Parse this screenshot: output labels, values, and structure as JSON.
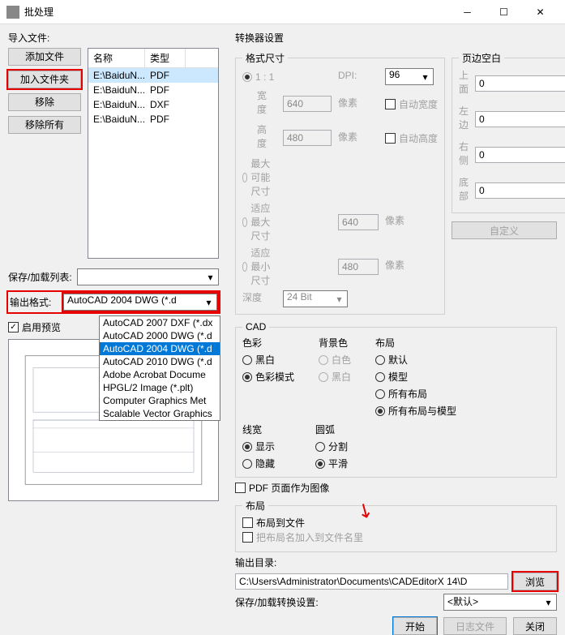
{
  "window": {
    "title": "批处理"
  },
  "left": {
    "import_label": "导入文件:",
    "add_file": "添加文件",
    "add_folder": "加入文件夹",
    "remove": "移除",
    "remove_all": "移除所有",
    "save_load_list": "保存/加载列表:",
    "output_format": "输出格式:",
    "format_value": "AutoCAD 2004 DWG (*.d",
    "enable_preview": "启用预览",
    "dropdown": [
      "AutoCAD 2007 DXF (*.dx",
      "AutoCAD 2000 DWG (*.d",
      "AutoCAD 2004 DWG (*.d",
      "AutoCAD 2010 DWG (*.d",
      "Adobe Acrobat Docume",
      "HPGL/2 Image (*.plt)",
      "Computer Graphics Met",
      "Scalable Vector Graphics"
    ]
  },
  "files": {
    "col_name": "名称",
    "col_type": "类型",
    "rows": [
      {
        "name": "E:\\BaiduN...",
        "type": "PDF"
      },
      {
        "name": "E:\\BaiduN...",
        "type": "PDF"
      },
      {
        "name": "E:\\BaiduN...",
        "type": "DXF"
      },
      {
        "name": "E:\\BaiduN...",
        "type": "PDF"
      }
    ]
  },
  "converter": {
    "title": "转换器设置",
    "format_size": "格式尺寸",
    "one_to_one": "1 : 1",
    "dpi": "DPI:",
    "dpi_val": "96",
    "width_lbl": "宽度",
    "width_val": "640",
    "height_lbl": "高度",
    "height_val": "480",
    "px": "像素",
    "auto_width": "自动宽度",
    "auto_height": "自动高度",
    "max_possible": "最大可能尺寸",
    "fit_max": "适应最大尺寸",
    "fit_max_val": "640",
    "fit_min": "适应最小尺寸",
    "fit_min_val": "480",
    "depth": "深度",
    "depth_val": "24 Bit",
    "margins": "页边空白",
    "top": "上面",
    "top_v": "0",
    "left": "左边",
    "left_v": "0",
    "right": "右侧",
    "right_v": "0",
    "bottom": "底部",
    "bottom_v": "0",
    "custom": "自定义",
    "cad": "CAD",
    "color": "色彩",
    "bw": "黑白",
    "colormode": "色彩模式",
    "bgcolor": "背景色",
    "white": "白色",
    "layout": "布局",
    "default": "默认",
    "model": "模型",
    "all_layouts": "所有布局",
    "all_layouts_model": "所有布局与模型",
    "linewidth": "线宽",
    "show": "显示",
    "hide": "隐藏",
    "arc": "圆弧",
    "split": "分割",
    "smooth": "平滑",
    "pdf_as_image": "PDF 页面作为图像",
    "layout_section": "布局",
    "layout_to_file": "布局到文件",
    "add_layout_name": "把布局名加入到文件名里",
    "output_dir": "输出目录:",
    "output_dir_val": "C:\\Users\\Administrator\\Documents\\CADEditorX 14\\D",
    "browse": "浏览",
    "save_load_conv": "保存/加载转换设置:",
    "default_combo": "<默认>",
    "start": "开始",
    "log": "日志文件",
    "close": "关闭"
  }
}
